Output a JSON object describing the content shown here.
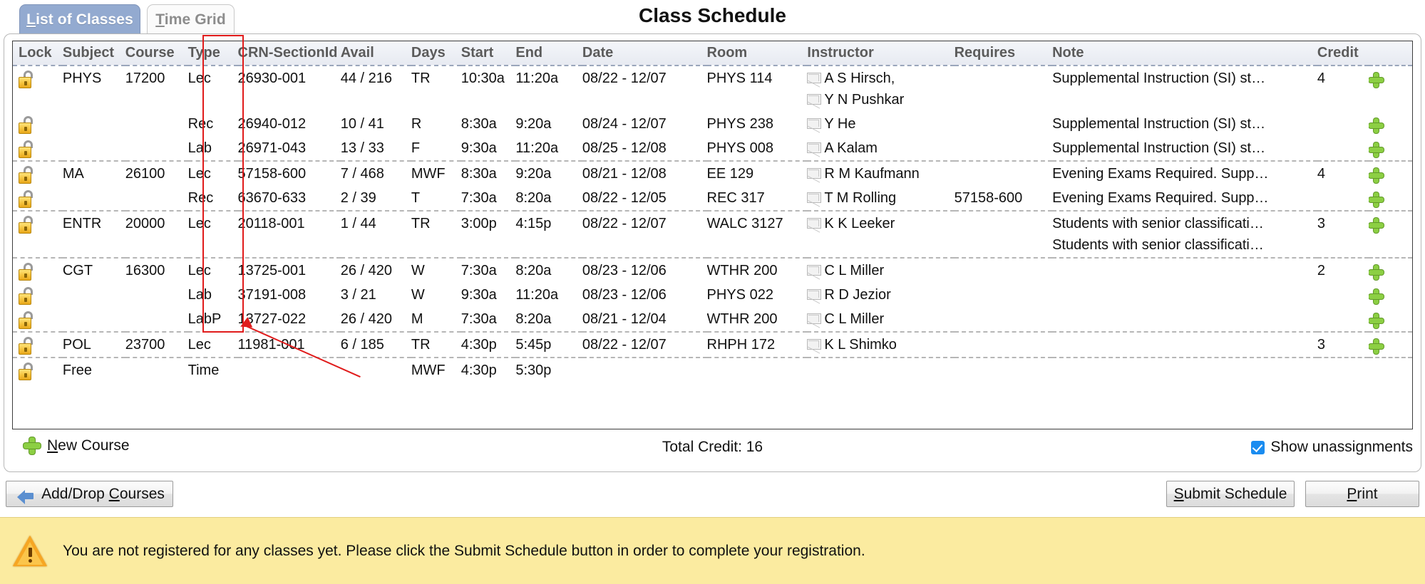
{
  "header": {
    "title": "Class Schedule",
    "tabs": [
      {
        "id": "list-of-classes",
        "label": "List of Classes",
        "accel": "L",
        "active": true
      },
      {
        "id": "time-grid",
        "label": "Time Grid",
        "accel": "T",
        "active": false
      }
    ]
  },
  "table": {
    "columns": [
      {
        "key": "lock",
        "label": "Lock"
      },
      {
        "key": "subject",
        "label": "Subject"
      },
      {
        "key": "course",
        "label": "Course"
      },
      {
        "key": "type",
        "label": "Type"
      },
      {
        "key": "crn",
        "label": "CRN-SectionId"
      },
      {
        "key": "avail",
        "label": "Avail"
      },
      {
        "key": "days",
        "label": "Days"
      },
      {
        "key": "start",
        "label": "Start"
      },
      {
        "key": "end",
        "label": "End"
      },
      {
        "key": "date",
        "label": "Date"
      },
      {
        "key": "room",
        "label": "Room"
      },
      {
        "key": "instructor",
        "label": "Instructor"
      },
      {
        "key": "requires",
        "label": "Requires"
      },
      {
        "key": "note",
        "label": "Note"
      },
      {
        "key": "credit",
        "label": "Credit"
      },
      {
        "key": "add",
        "label": ""
      }
    ],
    "rows": [
      {
        "lock": "unlocked",
        "subject": "PHYS",
        "course": "17200",
        "type": "Lec",
        "crn": "26930-001",
        "avail": "44 / 216",
        "days": "TR",
        "start": "10:30a",
        "end": "11:20a",
        "date": "08/22 - 12/07",
        "room": "PHYS 114",
        "instructors": [
          "A S Hirsch,",
          "Y N Pushkar"
        ],
        "requires": "",
        "notes": [
          "Supplemental Instruction (SI) st…"
        ],
        "credit": "4",
        "add": true,
        "group_start": true,
        "tall": true
      },
      {
        "lock": "unlocked",
        "subject": "",
        "course": "",
        "type": "Rec",
        "crn": "26940-012",
        "avail": "10 / 41",
        "days": "R",
        "start": "8:30a",
        "end": "9:20a",
        "date": "08/24 - 12/07",
        "room": "PHYS 238",
        "instructors": [
          "Y He"
        ],
        "requires": "",
        "notes": [
          "Supplemental Instruction (SI) st…"
        ],
        "credit": "",
        "add": true,
        "group_start": false,
        "tall": false
      },
      {
        "lock": "unlocked",
        "subject": "",
        "course": "",
        "type": "Lab",
        "crn": "26971-043",
        "avail": "13 / 33",
        "days": "F",
        "start": "9:30a",
        "end": "11:20a",
        "date": "08/25 - 12/08",
        "room": "PHYS 008",
        "instructors": [
          "A Kalam"
        ],
        "requires": "",
        "notes": [
          "Supplemental Instruction (SI) st…"
        ],
        "credit": "",
        "add": true,
        "group_start": false,
        "tall": false
      },
      {
        "lock": "unlocked",
        "subject": "MA",
        "course": "26100",
        "type": "Lec",
        "crn": "57158-600",
        "avail": "7 / 468",
        "days": "MWF",
        "start": "8:30a",
        "end": "9:20a",
        "date": "08/21 - 12/08",
        "room": "EE 129",
        "instructors": [
          "R M Kaufmann"
        ],
        "requires": "",
        "notes": [
          "Evening Exams Required. Supp…"
        ],
        "credit": "4",
        "add": true,
        "group_start": true,
        "tall": false
      },
      {
        "lock": "unlocked",
        "subject": "",
        "course": "",
        "type": "Rec",
        "crn": "63670-633",
        "avail": "2 / 39",
        "days": "T",
        "start": "7:30a",
        "end": "8:20a",
        "date": "08/22 - 12/05",
        "room": "REC 317",
        "instructors": [
          "T M Rolling"
        ],
        "requires": "57158-600",
        "notes": [
          "Evening Exams Required. Supp…"
        ],
        "credit": "",
        "add": true,
        "group_start": false,
        "tall": false
      },
      {
        "lock": "unlocked",
        "subject": "ENTR",
        "course": "20000",
        "type": "Lec",
        "crn": "20118-001",
        "avail": "1 / 44",
        "days": "TR",
        "start": "3:00p",
        "end": "4:15p",
        "date": "08/22 - 12/07",
        "room": "WALC 3127",
        "instructors": [
          "K K Leeker"
        ],
        "requires": "",
        "notes": [
          "Students with senior classificati…",
          "Students with senior classificati…"
        ],
        "credit": "3",
        "add": true,
        "group_start": true,
        "tall": true
      },
      {
        "lock": "unlocked",
        "subject": "CGT",
        "course": "16300",
        "type": "Lec",
        "crn": "13725-001",
        "avail": "26 / 420",
        "days": "W",
        "start": "7:30a",
        "end": "8:20a",
        "date": "08/23 - 12/06",
        "room": "WTHR 200",
        "instructors": [
          "C L Miller"
        ],
        "requires": "",
        "notes": [],
        "credit": "2",
        "add": true,
        "group_start": true,
        "tall": false
      },
      {
        "lock": "unlocked",
        "subject": "",
        "course": "",
        "type": "Lab",
        "crn": "37191-008",
        "avail": "3 / 21",
        "days": "W",
        "start": "9:30a",
        "end": "11:20a",
        "date": "08/23 - 12/06",
        "room": "PHYS 022",
        "instructors": [
          "R D Jezior"
        ],
        "requires": "",
        "notes": [],
        "credit": "",
        "add": true,
        "group_start": false,
        "tall": false
      },
      {
        "lock": "unlocked",
        "subject": "",
        "course": "",
        "type": "LabP",
        "crn": "13727-022",
        "avail": "26 / 420",
        "days": "M",
        "start": "7:30a",
        "end": "8:20a",
        "date": "08/21 - 12/04",
        "room": "WTHR 200",
        "instructors": [
          "C L Miller"
        ],
        "requires": "",
        "notes": [],
        "credit": "",
        "add": true,
        "group_start": false,
        "tall": false
      },
      {
        "lock": "unlocked",
        "subject": "POL",
        "course": "23700",
        "type": "Lec",
        "crn": "11981-001",
        "avail": "6 / 185",
        "days": "TR",
        "start": "4:30p",
        "end": "5:45p",
        "date": "08/22 - 12/07",
        "room": "RHPH 172",
        "instructors": [
          "K L Shimko"
        ],
        "requires": "",
        "notes": [],
        "credit": "3",
        "add": true,
        "group_start": true,
        "tall": false
      },
      {
        "lock": "unlocked",
        "subject": "Free",
        "course": "",
        "type": "Time",
        "crn": "",
        "avail": "",
        "days": "MWF",
        "start": "4:30p",
        "end": "5:30p",
        "date": "",
        "room": "",
        "instructors": [],
        "requires": "",
        "notes": [],
        "credit": "",
        "add": false,
        "group_start": true,
        "tall": false
      }
    ]
  },
  "footer": {
    "new_course_label": "New Course",
    "new_course_accel": "N",
    "total_credit_label": "Total Credit: 16",
    "show_unassignments_label": "Show unassignments",
    "show_unassignments_checked": true
  },
  "toolbar": {
    "add_drop_label_pre": "Add/Drop ",
    "add_drop_accel": "C",
    "add_drop_label_post": "ourses",
    "submit_accel": "S",
    "submit_label_post": "ubmit Schedule",
    "print_accel": "P",
    "print_label_post": "rint"
  },
  "warning": {
    "message": "You are not registered for any classes yet. Please click the Submit Schedule button in order to complete your registration.",
    "icon": "warning-triangle-icon",
    "background": "#fbeba0"
  },
  "annotation": {
    "type": "red-highlight-box",
    "target_column": "CRN-SectionId",
    "color": "#e01b1b"
  }
}
